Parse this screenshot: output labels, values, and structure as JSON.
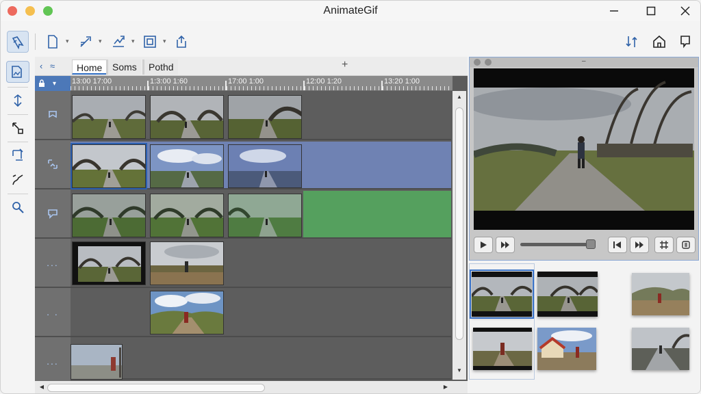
{
  "app": {
    "title": "AnimateGif"
  },
  "colors": {
    "accent": "#2f6ec4",
    "track_blue": "#6f82b3",
    "track_green": "#55a05e",
    "timeline_bg": "#5c5c5c"
  },
  "toolbar": {
    "items": [
      "select-tool-icon",
      "new-file-icon",
      "pen-icon",
      "chart-icon",
      "frame-icon",
      "export-icon"
    ],
    "right_items": [
      "sort-icon",
      "home-icon",
      "comment-icon"
    ]
  },
  "left_tools": [
    "layer-icon",
    "move-down-icon",
    "resize-icon",
    "crop-icon",
    "path-icon",
    "zoom-icon"
  ],
  "tabs": {
    "items": [
      {
        "label": "Home"
      },
      {
        "label": "Soms"
      },
      {
        "label": "Pothd"
      }
    ],
    "plus_label": "+"
  },
  "ruler": {
    "labels": [
      "13:00 17:00",
      "1:3:00 1:60",
      "17:00 1:00",
      "12:00 1:20",
      "13:20 1:00"
    ]
  },
  "tracks": {
    "header_dots": [
      "",
      "",
      "",
      "...",
      ". .",
      "..."
    ]
  }
}
